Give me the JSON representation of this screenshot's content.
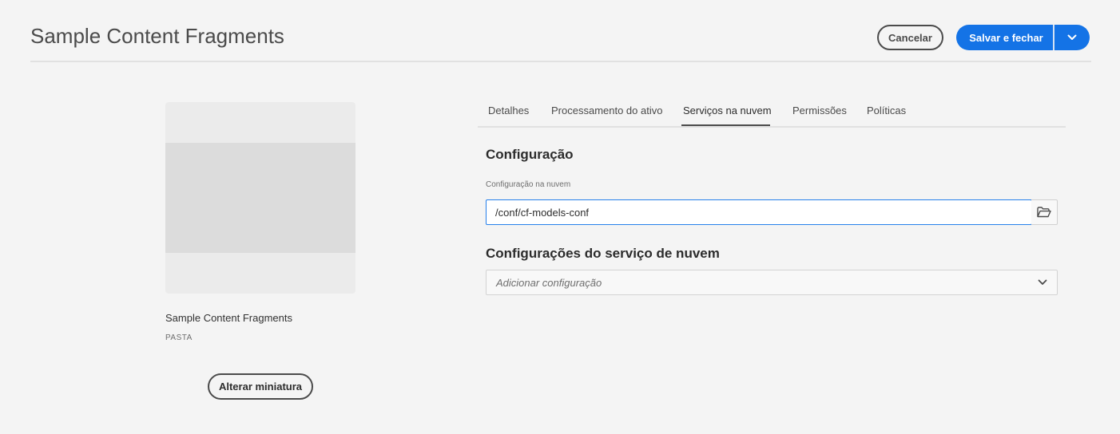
{
  "header": {
    "title": "Sample Content Fragments",
    "cancel_label": "Cancelar",
    "save_label": "Salvar e fechar",
    "accent_color": "#1473e6"
  },
  "asset": {
    "title": "Sample Content Fragments",
    "type": "PASTA",
    "change_thumbnail_label": "Alterar miniatura"
  },
  "tabs": [
    {
      "label": "Detalhes",
      "active": false
    },
    {
      "label": "Processamento do ativo",
      "active": false
    },
    {
      "label": "Serviços na nuvem",
      "active": true
    },
    {
      "label": "Permissões",
      "active": false
    },
    {
      "label": "Políticas",
      "active": false
    }
  ],
  "configuration": {
    "heading": "Configuração",
    "field_label": "Configuração na nuvem",
    "value": "/conf/cf-models-conf",
    "browse_icon": "folder-open-icon"
  },
  "cloud_services": {
    "heading": "Configurações do serviço de nuvem",
    "placeholder": "Adicionar configuração",
    "dropdown_icon": "chevron-down-icon"
  }
}
